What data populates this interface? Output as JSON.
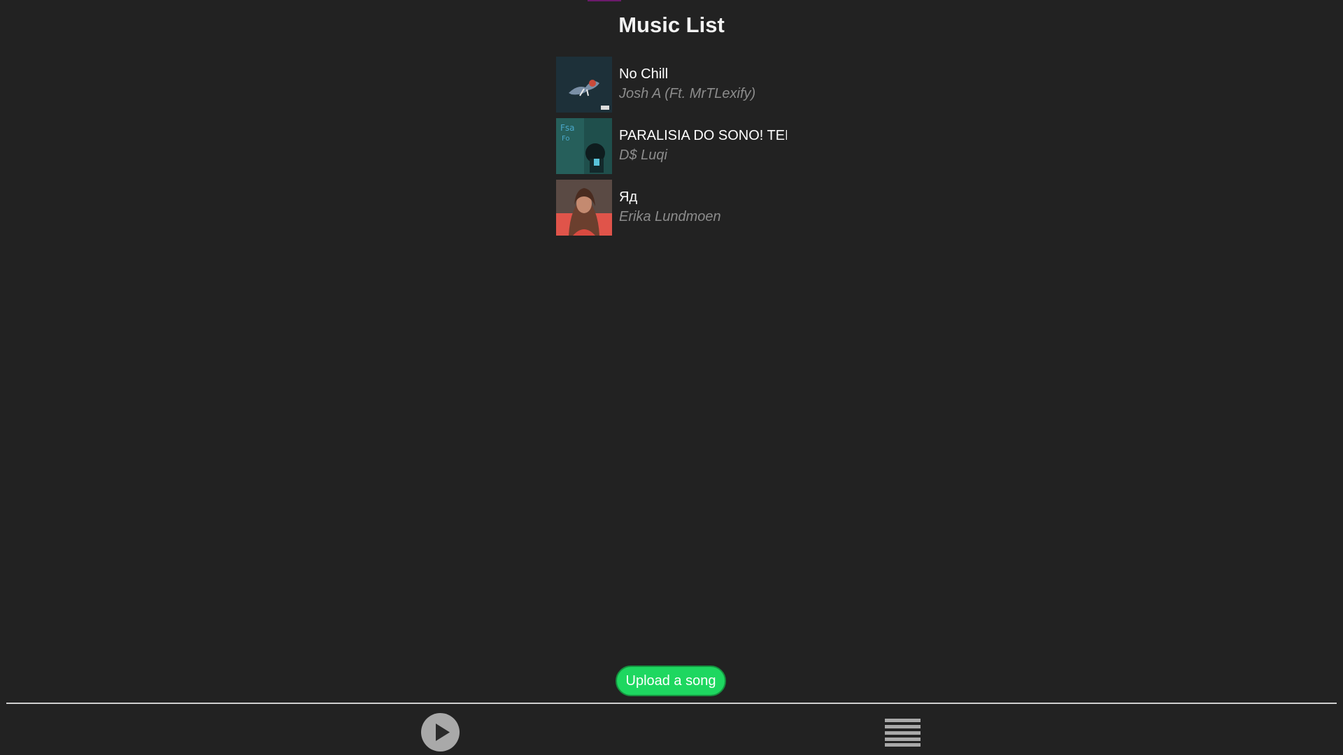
{
  "header": {
    "title": "Music List"
  },
  "songs": [
    {
      "title": "No Chill",
      "artist": "Josh A (Ft. MrTLexify)",
      "cover_icon": "album-cover-dark-blue"
    },
    {
      "title": "PARALISIA DO SONO! TEM",
      "artist": "D$ Luqi",
      "cover_icon": "album-cover-teal"
    },
    {
      "title": "Яд",
      "artist": "Erika Lundmoen",
      "cover_icon": "album-cover-portrait"
    }
  ],
  "actions": {
    "upload_label": "Upload a song"
  },
  "player": {
    "play_icon": "play-icon",
    "menu_icon": "menu-icon"
  },
  "colors": {
    "background": "#222222",
    "upload_button": "#1ed760",
    "artist_text": "#8c8c8c",
    "accent": "#6b1a6b"
  }
}
